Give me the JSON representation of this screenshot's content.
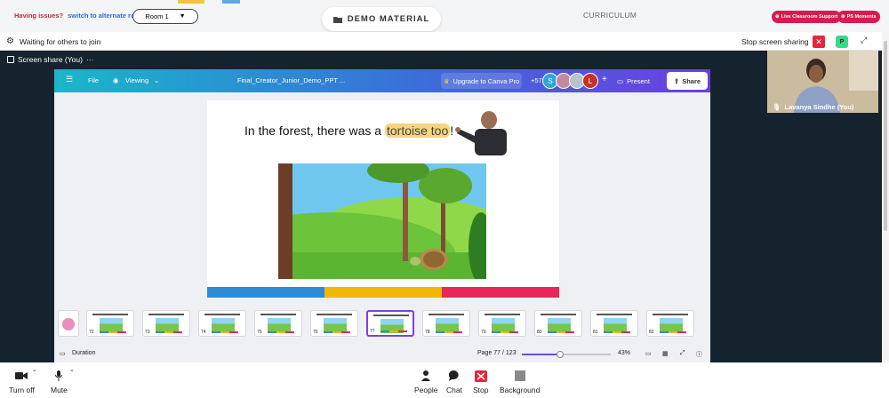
{
  "topbar": {
    "issues_text": "Having issues?",
    "switch_link": "switch to alternate room",
    "room_label": "Room 1",
    "demo_material": "DEMO MATERIAL",
    "curriculum": "CURRICULUM",
    "live_support": "Live Classroom Support",
    "moments": "PS Moments"
  },
  "waitbar": {
    "waiting_text": "Waiting for others to join",
    "stop_sharing": "Stop screen sharing",
    "p_badge": "P"
  },
  "share_label": "Screen share (You)",
  "canva": {
    "file": "File",
    "viewing": "Viewing",
    "doc_title": "Final_Creator_Junior_Demo_PPT ...",
    "upgrade": "Upgrade to Canva Pro",
    "collab_count": "+57",
    "avatar_s": "S",
    "avatar_l": "L",
    "present": "Present",
    "share": "Share",
    "slide_text_before": "In the forest, there was a ",
    "slide_text_highlight": "tortoise too",
    "slide_text_after": "!",
    "thumb_numbers": [
      "72",
      "73",
      "74",
      "75",
      "76",
      "77",
      "78",
      "79",
      "80",
      "81",
      "82"
    ],
    "selected_thumb": "77",
    "duration": "Duration",
    "page": "Page 77 / 123",
    "zoom": "43%",
    "zoom_level": 0.43
  },
  "video": {
    "name": "Lavanya Sindhe (You)"
  },
  "bottombar": {
    "turn_off": "Turn off",
    "mute": "Mute",
    "people": "People",
    "chat": "Chat",
    "stop": "Stop",
    "background": "Background"
  },
  "colors": {
    "stage": "#15232e",
    "accent_red": "#d81b4f",
    "canva_purple": "#7d3ee6",
    "bar_blue": "#2e8bd6",
    "bar_yellow": "#f2b705",
    "bar_pink": "#e8265a"
  }
}
